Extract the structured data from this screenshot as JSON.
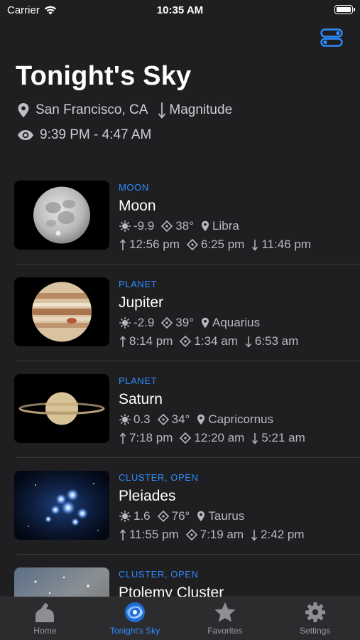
{
  "status": {
    "carrier": "Carrier",
    "time": "10:35 AM"
  },
  "header": {
    "title": "Tonight's Sky",
    "location": "San Francisco, CA",
    "sort_label": "Magnitude",
    "time_range": "9:39 PM - 4:47 AM"
  },
  "objects": [
    {
      "category": "MOON",
      "name": "Moon",
      "magnitude": "-9.9",
      "altitude": "38°",
      "constellation": "Libra",
      "rise": "12:56 pm",
      "transit": "6:25 pm",
      "set": "11:46 pm",
      "thumb": "moon"
    },
    {
      "category": "PLANET",
      "name": "Jupiter",
      "magnitude": "-2.9",
      "altitude": "39°",
      "constellation": "Aquarius",
      "rise": "8:14 pm",
      "transit": "1:34 am",
      "set": "6:53 am",
      "thumb": "jupiter"
    },
    {
      "category": "PLANET",
      "name": "Saturn",
      "magnitude": "0.3",
      "altitude": "34°",
      "constellation": "Capricornus",
      "rise": "7:18 pm",
      "transit": "12:20 am",
      "set": "5:21 am",
      "thumb": "saturn"
    },
    {
      "category": "CLUSTER, OPEN",
      "name": "Pleiades",
      "magnitude": "1.6",
      "altitude": "76°",
      "constellation": "Taurus",
      "rise": "11:55 pm",
      "transit": "7:19 am",
      "set": "2:42 pm",
      "thumb": "pleiades"
    },
    {
      "category": "CLUSTER, OPEN",
      "name": "Ptolemy Cluster",
      "thumb": "ptolemy"
    }
  ],
  "tabs": [
    {
      "label": "Home",
      "icon": "telescope-icon",
      "active": false
    },
    {
      "label": "Tonight's Sky",
      "icon": "galaxy-icon",
      "active": true
    },
    {
      "label": "Favorites",
      "icon": "star-icon",
      "active": false
    },
    {
      "label": "Settings",
      "icon": "gear-icon",
      "active": false
    }
  ],
  "colors": {
    "accent": "#2d8cff",
    "background": "#1f1f21",
    "tab_bar": "#2c2c2e",
    "secondary_text": "#b8b8be"
  }
}
